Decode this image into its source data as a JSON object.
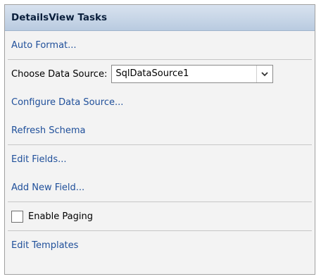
{
  "panel": {
    "title": "DetailsView Tasks",
    "auto_format": "Auto Format...",
    "data_source": {
      "label": "Choose Data Source:",
      "selected": "SqlDataSource1"
    },
    "configure_data_source": "Configure Data Source...",
    "refresh_schema": "Refresh Schema",
    "edit_fields": "Edit Fields...",
    "add_new_field": "Add New Field...",
    "enable_paging": {
      "label": "Enable Paging",
      "checked": false
    },
    "edit_templates": "Edit Templates"
  },
  "colors": {
    "header_bg": "#c8d6e8",
    "link": "#1f4f9a",
    "panel_bg": "#f3f3f3"
  }
}
